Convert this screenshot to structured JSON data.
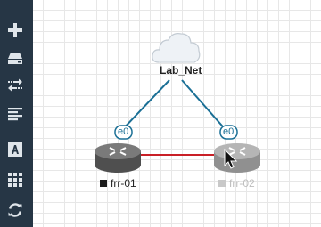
{
  "toolbar": {
    "items": [
      {
        "name": "add-node-button",
        "icon": "plus-icon"
      },
      {
        "name": "add-image-button",
        "icon": "drive-icon"
      },
      {
        "name": "add-network-button",
        "icon": "exchange-icon"
      },
      {
        "name": "align-button",
        "icon": "align-left-icon"
      },
      {
        "name": "add-text-button",
        "icon": "text-icon"
      },
      {
        "name": "grid-button",
        "icon": "grid-icon"
      },
      {
        "name": "refresh-button",
        "icon": "refresh-icon"
      }
    ]
  },
  "topology": {
    "cloud": {
      "label": "Lab_Net",
      "icon": "cloud-icon"
    },
    "links": [
      {
        "from": "Lab_Net",
        "to": "frr-01",
        "interface": "e0",
        "color": "#1a6f95"
      },
      {
        "from": "Lab_Net",
        "to": "frr-02",
        "interface": "e0",
        "color": "#1a6f95"
      },
      {
        "from": "frr-01",
        "to": "frr-02",
        "color": "#c91f26"
      }
    ],
    "nodes": [
      {
        "id": "frr-01",
        "label": "frr-01",
        "status": "running",
        "status_color": "#1b1b1b",
        "icon": "router-icon"
      },
      {
        "id": "frr-02",
        "label": "frr-02",
        "status": "stopped",
        "status_color": "#c8c8c8",
        "icon": "router-icon"
      }
    ]
  }
}
